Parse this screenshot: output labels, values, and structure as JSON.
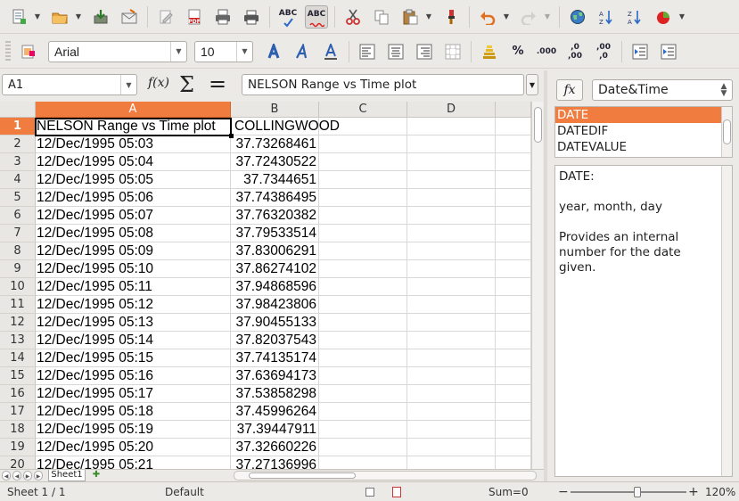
{
  "toolbar_standard": {
    "icons": [
      "new-document",
      "open-folder",
      "save",
      "send-email",
      "edit-file",
      "export-pdf",
      "print",
      "print-preview",
      "spellcheck",
      "autospellcheck",
      "cut",
      "copy",
      "paste",
      "clone-formatting",
      "undo",
      "redo",
      "navigator",
      "sort-ascending",
      "sort-descending",
      "chart"
    ],
    "spellcheck_label": "ABC",
    "pdf_label": "PDF"
  },
  "toolbar_format": {
    "font_name": "Arial",
    "font_size": "10",
    "percent_label": "%",
    "decimal_label": ".000",
    "add_decimal_label": ",0",
    "del_decimal_label": ",00"
  },
  "formula_bar": {
    "name_box": "A1",
    "fx_label": "f(x)",
    "sum_label": "Σ",
    "equals_label": "=",
    "formula": "NELSON Range vs Time plot"
  },
  "sheet": {
    "columns": [
      "A",
      "B",
      "C",
      "D"
    ],
    "selected_column": "A",
    "rows": [
      {
        "n": "1",
        "a": "NELSON Range vs Time plot",
        "b": "COLLINGWOOD"
      },
      {
        "n": "2",
        "a": "12/Dec/1995 05:03",
        "b": "37.73268461"
      },
      {
        "n": "3",
        "a": "12/Dec/1995 05:04",
        "b": "37.72430522"
      },
      {
        "n": "4",
        "a": "12/Dec/1995 05:05",
        "b": "37.7344651"
      },
      {
        "n": "5",
        "a": "12/Dec/1995 05:06",
        "b": "37.74386495"
      },
      {
        "n": "6",
        "a": "12/Dec/1995 05:07",
        "b": "37.76320382"
      },
      {
        "n": "7",
        "a": "12/Dec/1995 05:08",
        "b": "37.79533514"
      },
      {
        "n": "8",
        "a": "12/Dec/1995 05:09",
        "b": "37.83006291"
      },
      {
        "n": "9",
        "a": "12/Dec/1995 05:10",
        "b": "37.86274102"
      },
      {
        "n": "10",
        "a": "12/Dec/1995 05:11",
        "b": "37.94868596"
      },
      {
        "n": "11",
        "a": "12/Dec/1995 05:12",
        "b": "37.98423806"
      },
      {
        "n": "12",
        "a": "12/Dec/1995 05:13",
        "b": "37.90455133"
      },
      {
        "n": "13",
        "a": "12/Dec/1995 05:14",
        "b": "37.82037543"
      },
      {
        "n": "14",
        "a": "12/Dec/1995 05:15",
        "b": "37.74135174"
      },
      {
        "n": "15",
        "a": "12/Dec/1995 05:16",
        "b": "37.63694173"
      },
      {
        "n": "16",
        "a": "12/Dec/1995 05:17",
        "b": "37.53858298"
      },
      {
        "n": "17",
        "a": "12/Dec/1995 05:18",
        "b": "37.45996264"
      },
      {
        "n": "18",
        "a": "12/Dec/1995 05:19",
        "b": "37.39447911"
      },
      {
        "n": "19",
        "a": "12/Dec/1995 05:20",
        "b": "37.32660226"
      },
      {
        "n": "20",
        "a": "12/Dec/1995 05:21",
        "b": "37.27136996"
      }
    ],
    "active_tab": "Sheet1"
  },
  "function_panel": {
    "fx_label": "fx",
    "category": "Date&Time",
    "functions": [
      "DATE",
      "DATEDIF",
      "DATEVALUE"
    ],
    "selected_function": "DATE",
    "description": {
      "signature": "DATE:",
      "args": "year, month, day",
      "text": "Provides an internal number for the date given."
    }
  },
  "status_bar": {
    "sheet_info": "Sheet 1 / 1",
    "page_style": "Default",
    "sum": "Sum=0",
    "zoom_minus": "−",
    "zoom_plus": "+",
    "zoom": "120%"
  },
  "colors": {
    "accent": "#f07c3f",
    "toolbar_bg": "#eceae6",
    "grid_line": "#dad8d4"
  }
}
